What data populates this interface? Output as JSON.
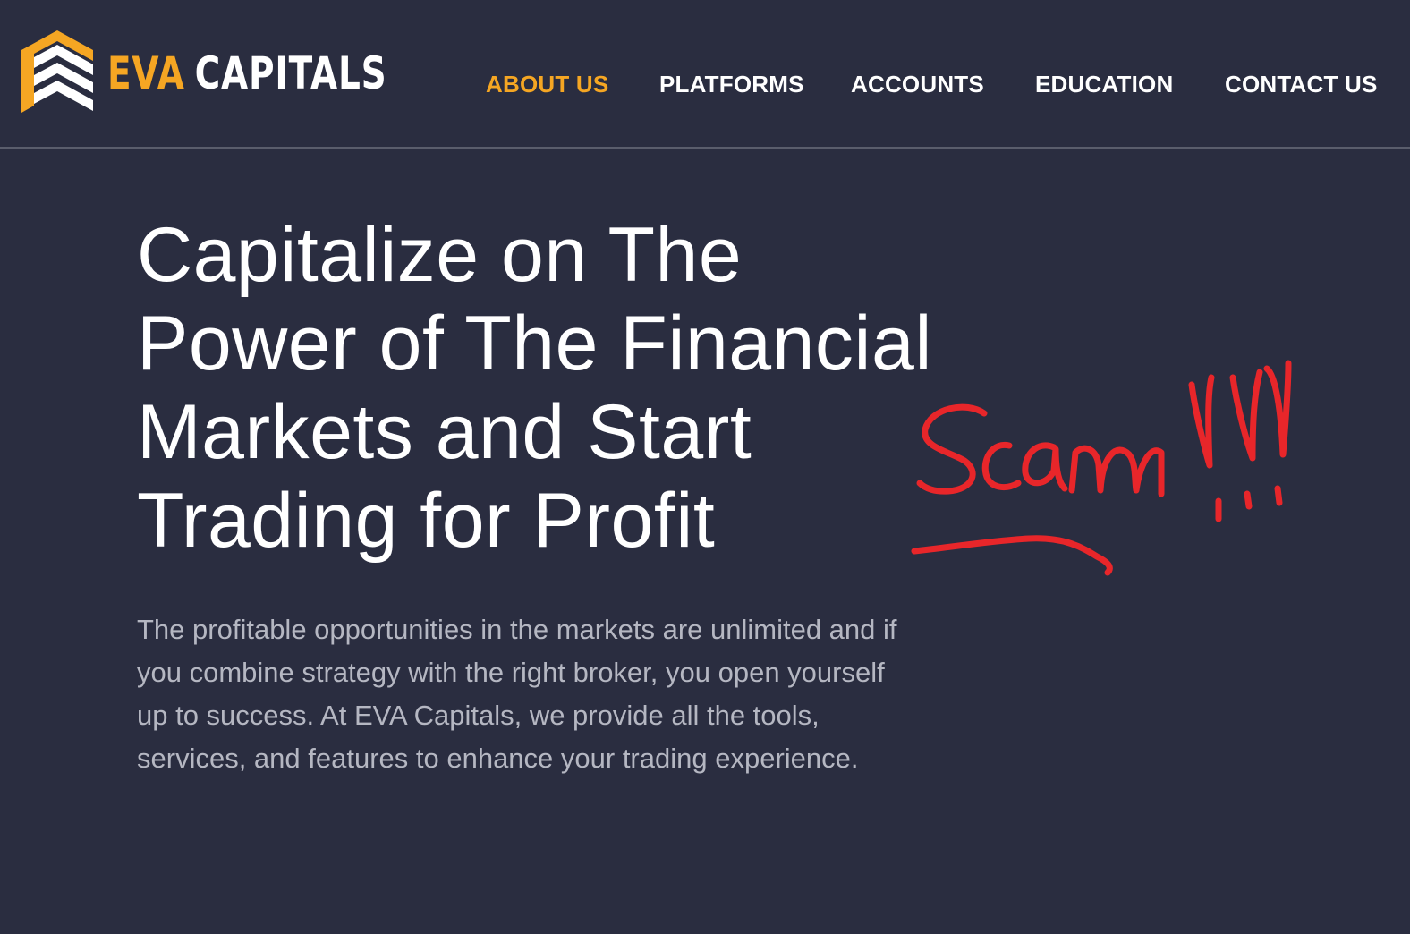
{
  "brand": {
    "name_part1": "EVA",
    "name_part2": "CAPITALS",
    "accent_color": "#f5a623",
    "background_color": "#2a2d40"
  },
  "nav": {
    "items": [
      {
        "label": "ABOUT US",
        "active": true
      },
      {
        "label": "PLATFORMS",
        "active": false
      },
      {
        "label": "ACCOUNTS",
        "active": false
      },
      {
        "label": "EDUCATION",
        "active": false
      },
      {
        "label": "CONTACT US",
        "active": false
      }
    ]
  },
  "hero": {
    "title_lines": [
      "Capitalize on The",
      "Power of The Financial",
      "Markets and Start",
      "Trading for Profit"
    ],
    "body_lines": [
      "The profitable opportunities in the markets are unlimited and if",
      "you combine strategy with the right broker, you open yourself",
      "up to success. At EVA Capitals, we provide all the tools,",
      "services, and features to enhance your trading experience."
    ]
  },
  "annotation": {
    "handwritten_text": "Scam!!!",
    "color": "#e8262a"
  }
}
